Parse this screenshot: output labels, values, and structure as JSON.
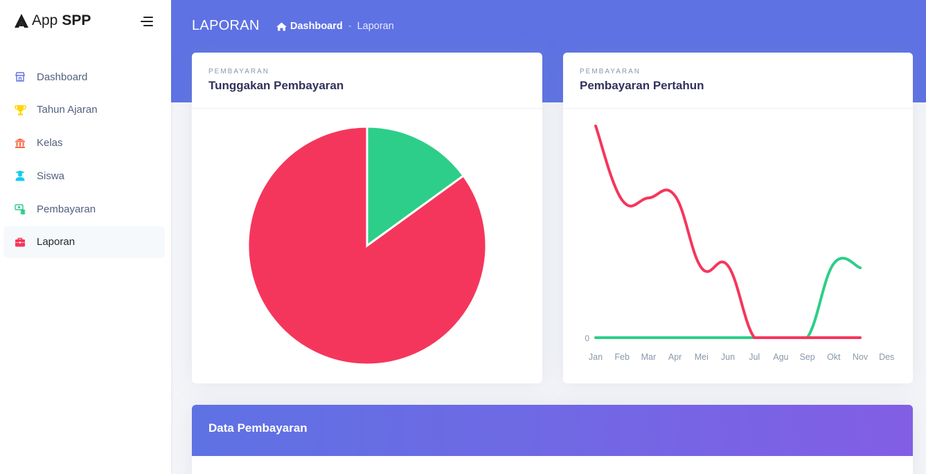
{
  "brand": {
    "app": "App",
    "name": "SPP"
  },
  "sidebar": {
    "items": [
      {
        "label": "Dashboard",
        "icon": "shop-icon",
        "color": "#5e72e4"
      },
      {
        "label": "Tahun Ajaran",
        "icon": "trophy-icon",
        "color": "#ffd600"
      },
      {
        "label": "Kelas",
        "icon": "building-icon",
        "color": "#fb6340"
      },
      {
        "label": "Siswa",
        "icon": "student-icon",
        "color": "#11cdef"
      },
      {
        "label": "Pembayaran",
        "icon": "money-icon",
        "color": "#2dce89"
      },
      {
        "label": "Laporan",
        "icon": "briefcase-icon",
        "color": "#f5365c"
      }
    ],
    "active": "Laporan"
  },
  "header": {
    "title": "LAPORAN",
    "breadcrumb": {
      "home": "Dashboard",
      "current": "Laporan",
      "separator": "-"
    }
  },
  "cards": {
    "tunggakan": {
      "overline": "PEMBAYARAN",
      "title": "Tunggakan Pembayaran"
    },
    "pertahun": {
      "overline": "PEMBAYARAN",
      "title": "Pembayaran Pertahun"
    },
    "data": {
      "title": "Data Pembayaran"
    }
  },
  "colors": {
    "primary": "#5e72e4",
    "red": "#f5365c",
    "green": "#2dce89"
  },
  "chart_data": [
    {
      "type": "pie",
      "slices": [
        {
          "value": 85,
          "color": "#f5365c"
        },
        {
          "value": 15,
          "color": "#2dce89"
        }
      ]
    },
    {
      "type": "line",
      "categories": [
        "Jan",
        "Feb",
        "Mar",
        "Apr",
        "Mei",
        "Jun",
        "Jul",
        "Agu",
        "Sep",
        "Okt",
        "Nov",
        "Des"
      ],
      "series": [
        {
          "color": "#f5365c",
          "values": [
            100,
            65,
            66,
            67,
            33,
            34,
            0,
            0,
            0,
            0,
            0,
            null
          ]
        },
        {
          "color": "#2dce89",
          "values": [
            0,
            0,
            0,
            0,
            0,
            0,
            0,
            0,
            0,
            35,
            33,
            null
          ]
        }
      ],
      "y_tick_labels": [
        "0"
      ],
      "ylim": [
        0,
        100
      ],
      "grid": false
    }
  ]
}
